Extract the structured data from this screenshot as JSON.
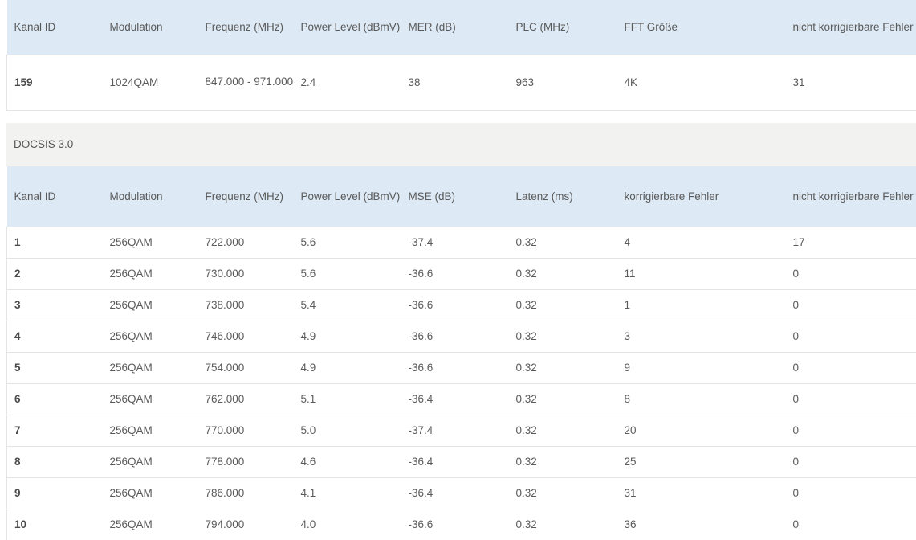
{
  "ofdm_table": {
    "headers": [
      "Kanal ID",
      "Modulation",
      "Frequenz (MHz)",
      "Power Level (dBmV)",
      "MER (dB)",
      "PLC (MHz)",
      "FFT Größe",
      "nicht korrigierbare Fehler"
    ],
    "rows": [
      [
        "159",
        "1024QAM",
        "847.000 - 971.000",
        "2.4",
        "38",
        "963",
        "4K",
        "31"
      ]
    ]
  },
  "section": {
    "title": "DOCSIS 3.0"
  },
  "docsis_table": {
    "headers": [
      "Kanal ID",
      "Modulation",
      "Frequenz (MHz)",
      "Power Level (dBmV)",
      "MSE (dB)",
      "Latenz (ms)",
      "korrigierbare Fehler",
      "nicht korrigierbare Fehler"
    ],
    "rows": [
      [
        "1",
        "256QAM",
        "722.000",
        "5.6",
        "-37.4",
        "0.32",
        "4",
        "17"
      ],
      [
        "2",
        "256QAM",
        "730.000",
        "5.6",
        "-36.6",
        "0.32",
        "11",
        "0"
      ],
      [
        "3",
        "256QAM",
        "738.000",
        "5.4",
        "-36.6",
        "0.32",
        "1",
        "0"
      ],
      [
        "4",
        "256QAM",
        "746.000",
        "4.9",
        "-36.6",
        "0.32",
        "3",
        "0"
      ],
      [
        "5",
        "256QAM",
        "754.000",
        "4.9",
        "-36.6",
        "0.32",
        "9",
        "0"
      ],
      [
        "6",
        "256QAM",
        "762.000",
        "5.1",
        "-36.4",
        "0.32",
        "8",
        "0"
      ],
      [
        "7",
        "256QAM",
        "770.000",
        "5.0",
        "-37.4",
        "0.32",
        "20",
        "0"
      ],
      [
        "8",
        "256QAM",
        "778.000",
        "4.6",
        "-36.4",
        "0.32",
        "25",
        "0"
      ],
      [
        "9",
        "256QAM",
        "786.000",
        "4.1",
        "-36.4",
        "0.32",
        "31",
        "0"
      ],
      [
        "10",
        "256QAM",
        "794.000",
        "4.0",
        "-36.6",
        "0.32",
        "36",
        "0"
      ]
    ]
  },
  "colors": {
    "header_bg": "#dde9f4",
    "section_bg": "#f2f2f0",
    "row_border": "#e4e4e4",
    "text": "#5a5a5a"
  }
}
